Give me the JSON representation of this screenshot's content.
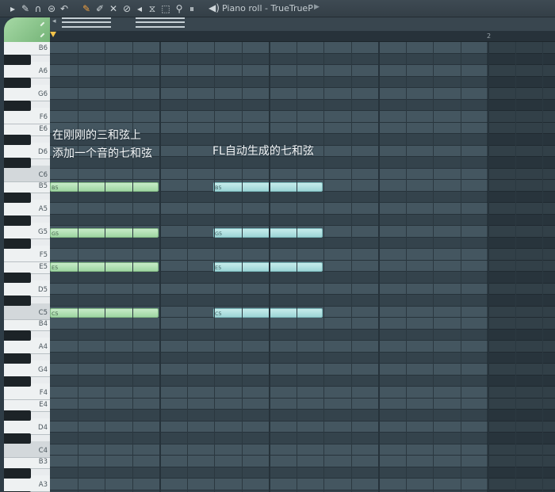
{
  "toolbar": {
    "title": "Piano roll - TrueTrueP",
    "icons": [
      "play-arrow-icon",
      "wrench-icon",
      "magnet-icon",
      "menu-icon",
      "undo-icon",
      "pencil-icon",
      "paint-icon",
      "delete-icon",
      "mute-icon",
      "slice-icon",
      "select-icon",
      "zoom-icon",
      "playback-icon"
    ]
  },
  "timeline": {
    "bar_number": "2"
  },
  "keyboard": {
    "labels": [
      "B6",
      "A6",
      "G6",
      "F6",
      "E6",
      "D6",
      "C6",
      "B5",
      "A5",
      "G5",
      "F5",
      "E5",
      "D5",
      "C5",
      "B4",
      "A4",
      "G4",
      "F4",
      "E4",
      "D4",
      "C4",
      "B3",
      "A3"
    ]
  },
  "notes": {
    "left": [
      "B5",
      "G5",
      "E5",
      "C5"
    ],
    "right": [
      "B5",
      "G5",
      "E5",
      "C5"
    ]
  },
  "annotations": {
    "left_line1": "在刚刚的三和弦上",
    "left_line2": "添加一个音的七和弦",
    "right": "FL自动生成的七和弦"
  },
  "colors": {
    "left_notes": "#a8dcaa",
    "right_notes": "#a5dcdc",
    "tool_corner": "#8cc98d"
  }
}
